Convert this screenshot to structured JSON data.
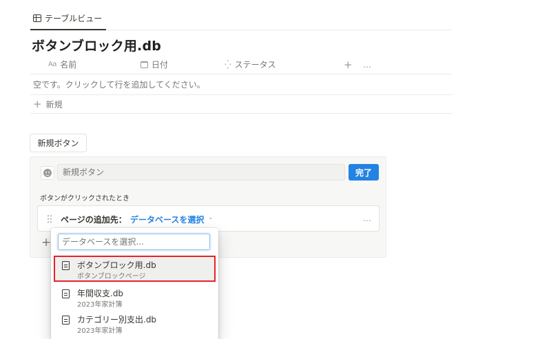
{
  "view_tab": {
    "label": "テーブルビュー"
  },
  "database": {
    "title": "ボタンブロック用.db"
  },
  "table": {
    "columns": [
      {
        "prefix": "Aa",
        "label": "名前"
      },
      {
        "label": "日付"
      },
      {
        "label": "ステータス"
      }
    ],
    "add_column": "+",
    "more": "…",
    "empty_message": "空です。クリックして行を追加してください。",
    "new_label": "新規"
  },
  "button_block": {
    "label": "新規ボタン"
  },
  "config": {
    "name_placeholder": "新規ボタン",
    "done_label": "完了",
    "trigger_label": "ボタンがクリックされたとき",
    "action": {
      "label": "ページの追加先：",
      "value": "データベースを選択",
      "chevron": "⌄",
      "more": "…"
    },
    "add_step": "+"
  },
  "dropdown": {
    "search_placeholder": "データベースを選択...",
    "options": [
      {
        "title": "ボタンブロック用.db",
        "subtitle": "ボタンブロックページ",
        "selected": true
      },
      {
        "title": "年間収支.db",
        "subtitle": "2023年家計簿",
        "selected": false
      },
      {
        "title": "カテゴリー別支出.db",
        "subtitle": "2023年家計簿",
        "selected": false
      }
    ]
  },
  "colors": {
    "accent": "#2383e2",
    "highlight": "#e5222b"
  }
}
